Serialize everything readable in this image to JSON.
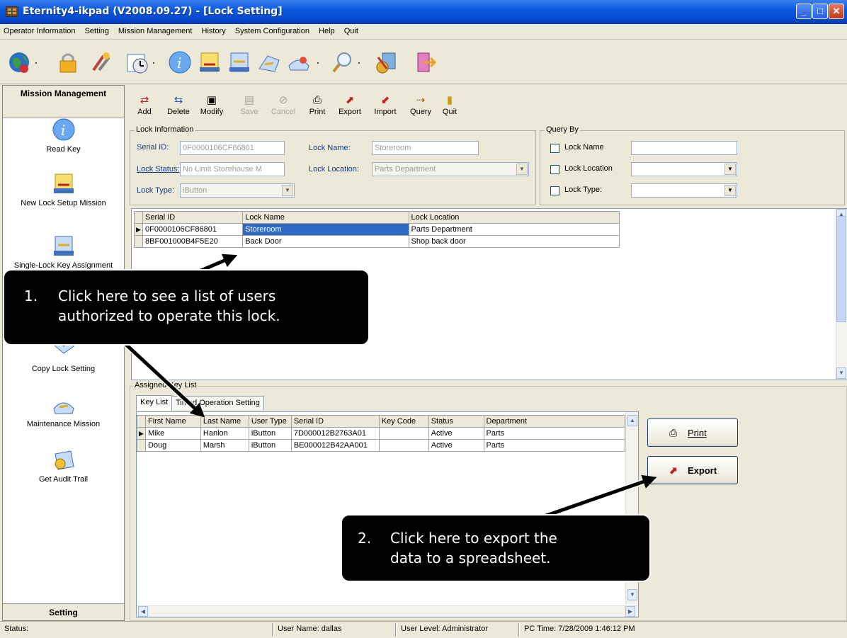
{
  "window": {
    "title": "Eternity4-ikpad   (V2008.09.27) - [Lock Setting]"
  },
  "menu": [
    "Operator Information",
    "Setting",
    "Mission Management",
    "History",
    "System Configuration",
    "Help",
    "Quit"
  ],
  "sidebar": {
    "header": "Mission Management",
    "footer": "Setting",
    "items": [
      {
        "label": "Read Key"
      },
      {
        "label": "New Lock Setup Mission"
      },
      {
        "label": "Single-Lock Key Assignment"
      },
      {
        "label": "Copy Lock Setting"
      },
      {
        "label": "Maintenance Mission"
      },
      {
        "label": "Get Audit Trail"
      }
    ]
  },
  "mission_toolbar": [
    "Add",
    "Delete",
    "Modify",
    "Save",
    "Cancel",
    "Print",
    "Export",
    "Import",
    "Query",
    "Quit"
  ],
  "lock_info": {
    "title": "Lock Information",
    "serial_id_label": "Serial ID:",
    "serial_id": "0F0000106CF86801",
    "lock_name_label": "Lock Name:",
    "lock_name": "Storeroom",
    "lock_status_label": "Lock Status:",
    "lock_status": "No Limit Storehouse M",
    "lock_location_label": "Lock Location:",
    "lock_location": "Parts Department",
    "lock_type_label": "Lock Type:",
    "lock_type": "iButton"
  },
  "query_by": {
    "title": "Query By",
    "options": [
      "Lock Name",
      "Lock Location",
      "Lock Type:"
    ]
  },
  "lock_grid": {
    "columns": [
      "Serial ID",
      "Lock Name",
      "Lock Location"
    ],
    "rows": [
      [
        "0F0000106CF86801",
        "Storeroom",
        "Parts Department"
      ],
      [
        "8BF001000B4F5E20",
        "Back Door",
        "Shop back door"
      ]
    ]
  },
  "assigned": {
    "title": "Assigned Key List",
    "tabs": [
      "Key List",
      "Timed Operation Setting"
    ],
    "columns": [
      "First Name",
      "Last Name",
      "User Type",
      "Serial ID",
      "Key Code",
      "Status",
      "Department"
    ],
    "rows": [
      [
        "Mike",
        "Hanlon",
        "iButton",
        "7D000012B2763A01",
        "",
        "Active",
        "Parts"
      ],
      [
        "Doug",
        "Marsh",
        "iButton",
        "BE000012B42AA001",
        "",
        "Active",
        "Parts"
      ]
    ],
    "print_label": "Print",
    "export_label": "Export"
  },
  "callouts": {
    "one_num": "1.",
    "one_line1": "Click here to see a list of users",
    "one_line2": "authorized to operate this lock.",
    "two_num": "2.",
    "two_line1": "Click here to export the",
    "two_line2": "data to a spreadsheet."
  },
  "status": {
    "label": "Status:",
    "user_name": "User Name:  dallas",
    "user_level": "User Level:  Administrator",
    "pc_time": "PC Time:  7/28/2009 1:46:12 PM"
  }
}
